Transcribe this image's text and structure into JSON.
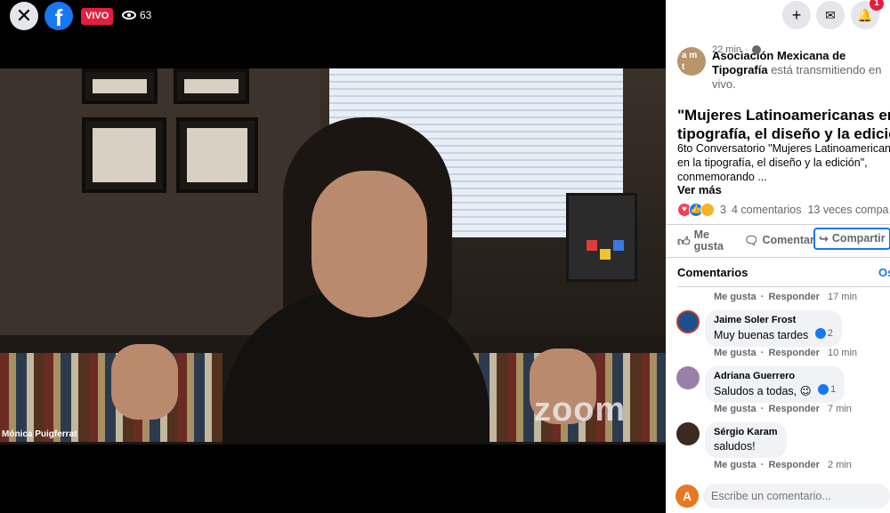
{
  "top_bar": {
    "close_glyph": "✕",
    "facebook_glyph": "f",
    "live_label": "VIVO",
    "viewer_count": "63"
  },
  "video": {
    "participant_name": "Mónica Puigferrat",
    "watermark": "zoom"
  },
  "panel_actions": {
    "create_glyph": "+",
    "messenger_glyph": "✉",
    "notifications_glyph": "🔔",
    "notification_count": "1"
  },
  "post": {
    "avatar_text": "a m\nt",
    "author": "Asociación Mexicana de Tipografía",
    "author_action": " está transmitiendo en vivo.",
    "time": "22 min",
    "title_line1": "\"Mujeres Latinoamericanas en l",
    "title_line2": "tipografía, el diseño y la edición",
    "desc_line1": "6to Conversatorio \"Mujeres Latinoamerican",
    "desc_line2": "en la tipografía, el diseño y la edición\",",
    "desc_line3": "conmemorando ...",
    "see_more": "Ver más",
    "reaction_count": "3",
    "comment_count": "4 comentarios",
    "share_count": "13 veces compa"
  },
  "actions": {
    "like_line1": "Me",
    "like_line2": "gusta",
    "comment_label": "Comentar",
    "share_label": "Compartir"
  },
  "comments_section": {
    "header": "Comentarios",
    "filter_label": "Os",
    "first_meta": {
      "like": "Me gusta",
      "reply": "Responder",
      "time": "17 min"
    },
    "items": [
      {
        "author": "Jaime Soler Frost",
        "text": "Muy buenas tardes",
        "likes": "2",
        "like": "Me gusta",
        "reply": "Responder",
        "time": "10 min"
      },
      {
        "author": "Adriana Guerrero",
        "text": "Saludos a todas, 😉",
        "likes": "1",
        "like": "Me gusta",
        "reply": "Responder",
        "time": "7 min"
      },
      {
        "author": "Sérgio Karam",
        "text": "saludos!",
        "likes": "",
        "like": "Me gusta",
        "reply": "Responder",
        "time": "2 min"
      }
    ]
  },
  "composer": {
    "avatar_letter": "A",
    "placeholder": "Escribe un comentario..."
  },
  "colors": {
    "facebook_blue": "#1877f2",
    "live_red": "#e41e3f",
    "text_secondary": "#65676b",
    "bubble_bg": "#f0f2f5"
  }
}
